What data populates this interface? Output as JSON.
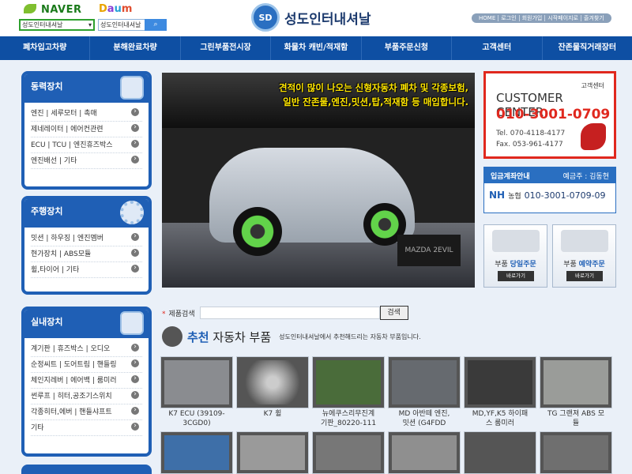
{
  "header": {
    "naver": "NAVER",
    "daum": [
      "D",
      "a",
      "u",
      "m"
    ],
    "select_value": "성도인터내셔날",
    "go": "검색",
    "search_value": "성도인터내셔날",
    "search_icon": "search-icon",
    "brand_badge": "SD",
    "brand_name": "성도인터내셔날",
    "util_links": [
      "HOME",
      "로그인",
      "회원가입",
      "시작페이지로",
      "즐겨찾기"
    ]
  },
  "nav": [
    "폐차입고차량",
    "분해완료차량",
    "그린부품전시장",
    "화물차 캐빈/적재함",
    "부품주문신청",
    "고객센터",
    "잔존물직거래장터"
  ],
  "sidebar": [
    {
      "title": "동력장치",
      "items": [
        "엔진 | 세루모터 | 촉매",
        "제네레이터 | 에어컨관련",
        "ECU | TCU | 엔진휴즈박스",
        "엔진배선 | 기타"
      ]
    },
    {
      "title": "주행장치",
      "items": [
        "밋션 | 하우징 | 엔진멤버",
        "현가장치 | ABS모듈",
        "휠,타이어 | 기타"
      ]
    },
    {
      "title": "실내장치",
      "items": [
        "계기판 | 휴즈박스 | 오디오",
        "순정씨트 | 도어트림 | 핸들링",
        "체인지레버 | 에어백 | 룸미러",
        "썬루프 | 히터,공조기스위치",
        "각종히터,에버 | 핸들샤프트",
        "기타"
      ]
    }
  ],
  "banner": {
    "caption_1": "견적이 많이 나오는 신형자동차 폐차 및 각종보험,",
    "caption_2": "일반 잔존물,엔진,밋션,탑,적재함 등 매입합니다.",
    "plate": "MAZDA 2EVIL"
  },
  "customer_center": {
    "label": "고객센터",
    "title": "CUSTOMER CENTER",
    "phone": "010-3001-0709",
    "tel": "Tel. 070-4118-4177",
    "fax": "Fax. 053-961-4177"
  },
  "bank": {
    "title": "입금계좌안내",
    "holder": "예금주 : 김동현",
    "logo": "NH",
    "bank_name": "농협",
    "account": "010-3001-0709-09"
  },
  "quick": [
    {
      "title_a": "부품",
      "title_b": "당일주문",
      "button": "바로가기"
    },
    {
      "title_a": "부품",
      "title_b": "예약주문",
      "button": "바로가기"
    }
  ],
  "search": {
    "label": "제품검색",
    "button": "검색"
  },
  "recommend": {
    "title_a": "추천",
    "title_b": "자동차 부품",
    "subtitle": "성도인터내셔날에서 추천해드리는 자동차 부품입니다."
  },
  "products": [
    {
      "name_1": "K7 ECU (39109-",
      "name_2": "3CGD0)"
    },
    {
      "name_1": "K7 휠",
      "name_2": ""
    },
    {
      "name_1": "뉴에쿠스리무진계",
      "name_2": "기판_80220-111"
    },
    {
      "name_1": "MD 아반떼 엔진,",
      "name_2": "밋션 (G4FDD"
    },
    {
      "name_1": "MD,YF,K5 하이패",
      "name_2": "스 룸미러"
    },
    {
      "name_1": "TG 그랜져 ABS 모",
      "name_2": "듈"
    }
  ]
}
